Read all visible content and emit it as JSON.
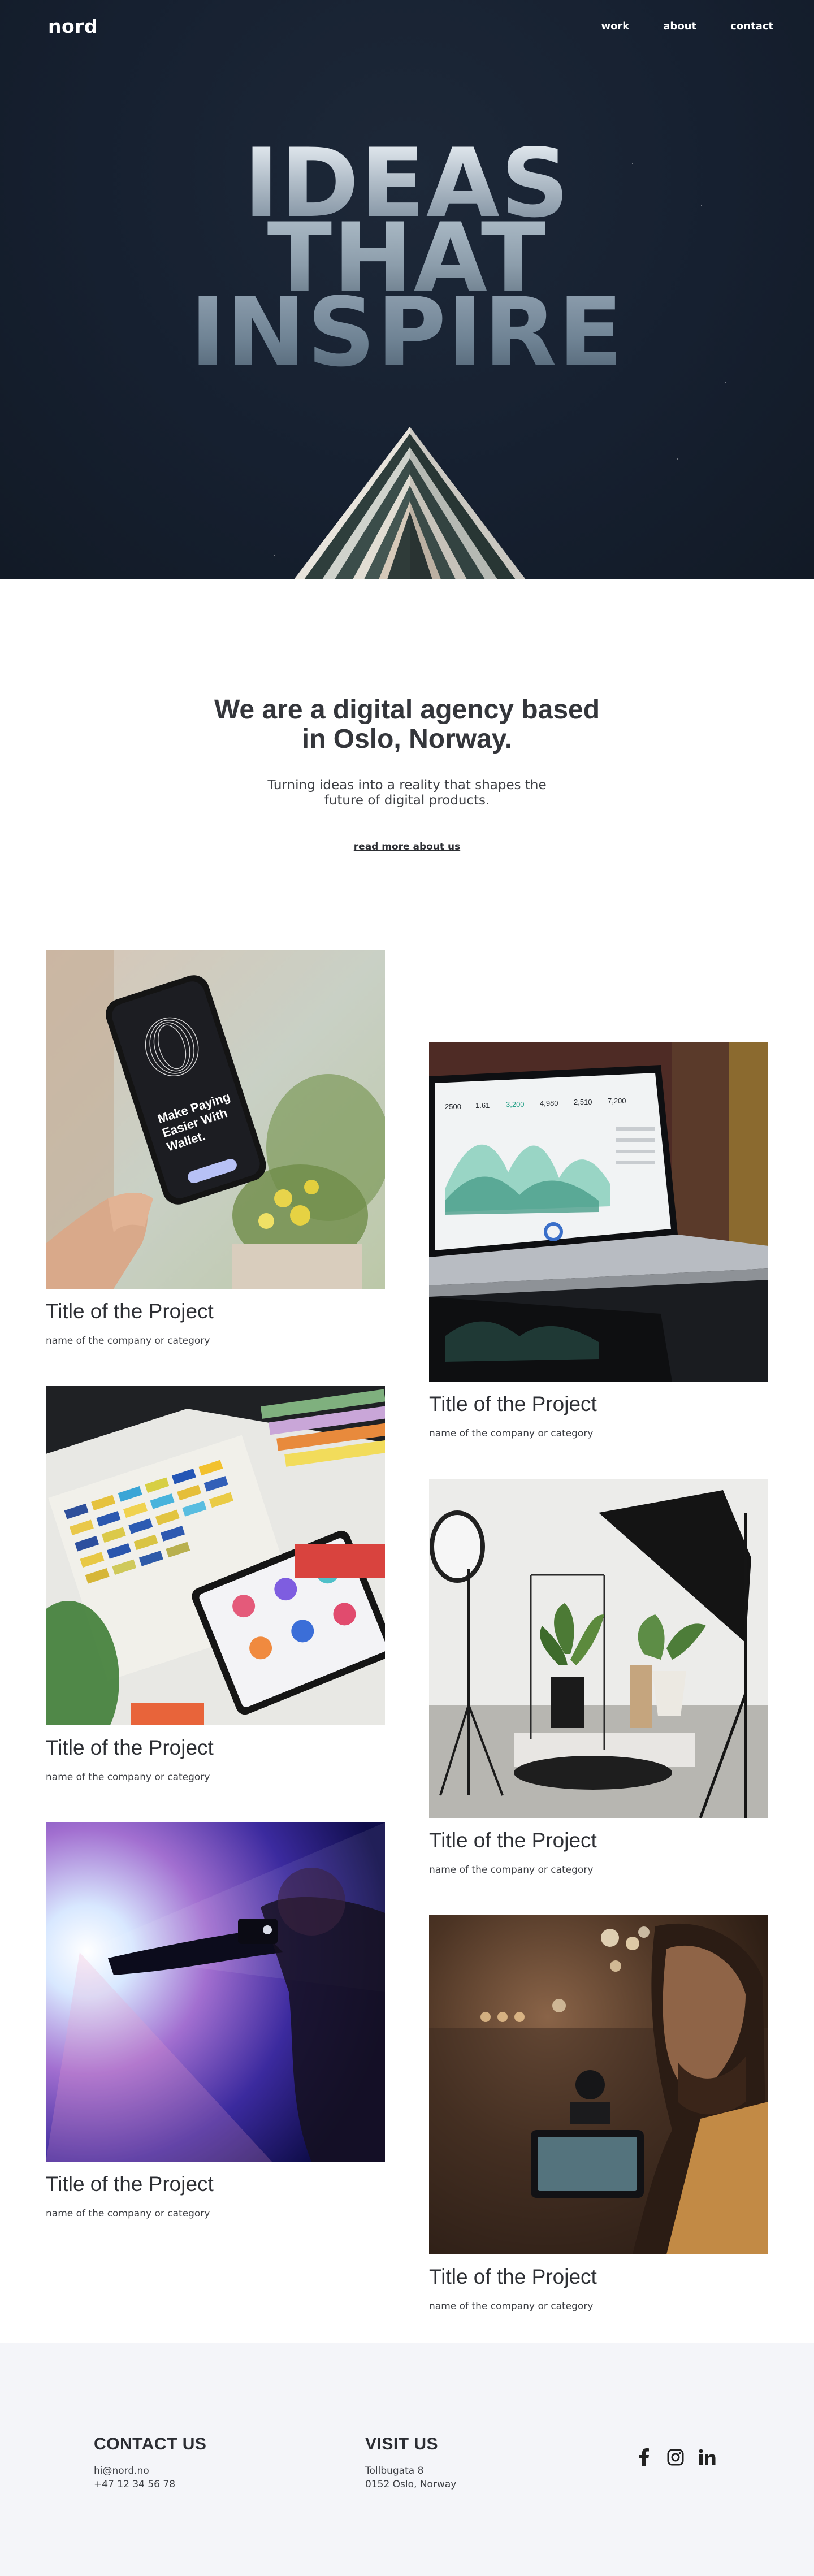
{
  "nav": {
    "logo": "nord",
    "links": [
      "work",
      "about",
      "contact"
    ]
  },
  "hero": {
    "lines": [
      "IDEAS",
      "THAT",
      "INSPIRE"
    ]
  },
  "about": {
    "heading": "We are a digital agency based in Oslo, Norway.",
    "text": "Turning ideas into a reality that shapes the future of digital products.",
    "link": "read more about us"
  },
  "projects": [
    {
      "title": "Title of the Project",
      "sub": "name of the company or category",
      "image": "hand-holding-phone-wallet-app",
      "phone_text": "Make Paying Easier With Wallet."
    },
    {
      "title": "Title of the Project",
      "sub": "name of the company or category",
      "image": "laptop-analytics-dashboard",
      "stats": [
        "2500",
        "1.61",
        "3,200",
        "4,980",
        "2,510",
        "7,200"
      ]
    },
    {
      "title": "Title of the Project",
      "sub": "name of the company or category",
      "image": "color-swatches-tablet"
    },
    {
      "title": "Title of the Project",
      "sub": "name of the company or category",
      "image": "photo-studio-lights-plants"
    },
    {
      "title": "Title of the Project",
      "sub": "name of the company or category",
      "image": "projector-light-hands"
    },
    {
      "title": "Title of the Project",
      "sub": "name of the company or category",
      "image": "man-with-camera-bokeh"
    }
  ],
  "footer": {
    "contact": {
      "title": "CONTACT US",
      "lines": [
        "hi@nord.no",
        "+47 12 34 56 78"
      ]
    },
    "visit": {
      "title": "VISIT US",
      "lines": [
        "Tollbugata 8",
        "0152 Oslo, Norway"
      ]
    },
    "social": [
      "facebook-icon",
      "instagram-icon",
      "linkedin-icon"
    ]
  },
  "colors": {
    "hero_bg": "#17202e",
    "footer_bg": "#f4f5f9",
    "text": "#2b2d33"
  }
}
